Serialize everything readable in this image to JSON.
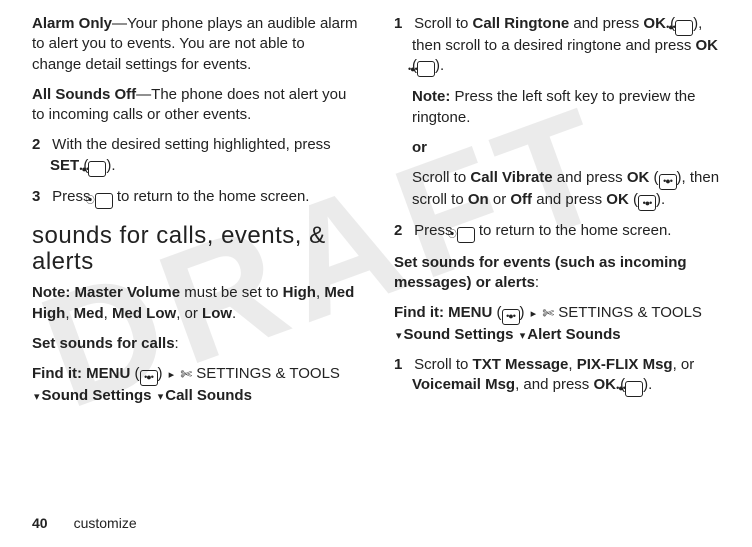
{
  "watermark": "DRAFT",
  "left": {
    "alarm_only_title": "Alarm Only",
    "alarm_only_body": "—Your phone plays an audible alarm to alert you to events. You are not able to change detail settings for events.",
    "all_off_title": "All Sounds Off",
    "all_off_body": "—The phone does not alert you to incoming calls or other events.",
    "step2_num": "2",
    "step2_a": "With the desired setting highlighted, press ",
    "step2_set": "SET",
    "step2_b": " (",
    "step2_c": ").",
    "step3_num": "3",
    "step3_a": "Press ",
    "step3_b": " to return to the home screen.",
    "section_title": "sounds for calls, events, & alerts",
    "note_label": "Note:",
    "note_a": " ",
    "note_mv": "Master Volume",
    "note_b": " must be set to ",
    "note_high": "High",
    "note_c": ", ",
    "note_medhigh": "Med High",
    "note_d": ", ",
    "note_med": "Med",
    "note_e": ", ",
    "note_medlow": "Med Low",
    "note_f": ", or ",
    "note_low": "Low",
    "note_g": ".",
    "set_calls": "Set sounds for calls",
    "set_calls_colon": ":",
    "find_label": "Find it:",
    "find_menu": "MENU",
    "find_paren_a": " (",
    "find_paren_b": ") ",
    "find_settings": "SETTINGS & TOOLS",
    "find_sound": "Sound Settings",
    "find_call": "Call Sounds"
  },
  "right": {
    "s1_num": "1",
    "s1_a": "Scroll to ",
    "s1_callring": "Call Ringtone",
    "s1_b": " and press ",
    "s1_ok1": "OK",
    "s1_c": " (",
    "s1_d": "), then scroll to a desired ringtone and press ",
    "s1_ok2": "OK",
    "s1_e": " (",
    "s1_f": ").",
    "note2_label": "Note:",
    "note2_body": " Press the left soft key to preview the ringtone.",
    "or": "or",
    "s1v_a": "Scroll to ",
    "s1v_callvib": "Call Vibrate",
    "s1v_b": " and press ",
    "s1v_ok1": "OK",
    "s1v_c": " (",
    "s1v_d": "), then scroll to ",
    "s1v_on": "On",
    "s1v_e": " or ",
    "s1v_off": "Off",
    "s1v_f": " and press ",
    "s1v_ok2": "OK",
    "s1v_g": " (",
    "s1v_h": ").",
    "s2_num": "2",
    "s2_a": "Press ",
    "s2_b": " to return to the home screen.",
    "events_a": "Set sounds for events (such as incoming messages) or alerts",
    "events_b": ":",
    "find2_label": "Find it:",
    "find2_menu": "MENU",
    "find2_a": " (",
    "find2_b": ") ",
    "find2_settings": "SETTINGS & TOOLS",
    "find2_sound": "Sound Settings",
    "find2_alert": "Alert Sounds",
    "e1_num": "1",
    "e1_a": "Scroll to ",
    "e1_txt": "TXT Message",
    "e1_b": ", ",
    "e1_pix": "PIX-FLIX Msg",
    "e1_c": ", or ",
    "e1_vm": "Voicemail Msg",
    "e1_d": ", and press ",
    "e1_ok": "OK",
    "e1_e": " (",
    "e1_f": ")."
  },
  "footer": {
    "page": "40",
    "section": "customize"
  }
}
